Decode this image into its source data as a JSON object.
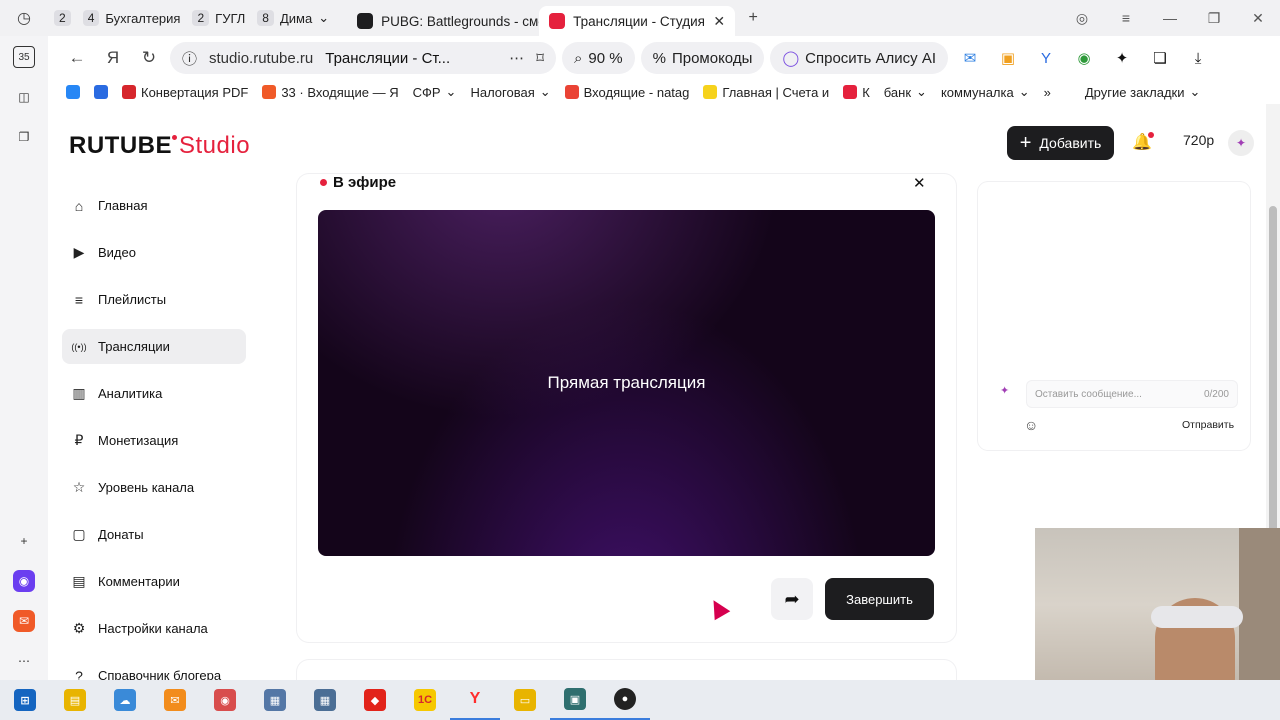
{
  "browser": {
    "tab_groups": [
      {
        "count": "2",
        "label": ""
      },
      {
        "count": "4",
        "label": "Бухгалтерия"
      },
      {
        "count": "2",
        "label": "ГУГЛ"
      },
      {
        "count": "8",
        "label": "Дима"
      }
    ],
    "tabs": [
      {
        "title": "PUBG: Battlegrounds - смо",
        "fav_color": "#1d1d1f"
      },
      {
        "title": "Трансляции - Студия R",
        "fav_color": "#e5213d",
        "active": true
      }
    ],
    "url": "studio.rutube.ru",
    "page_title": "Трансляции - Ст...",
    "zoom": "90 %",
    "promo_label": "Промокоды",
    "alice_label": "Спросить Алису AI",
    "bookmarks": [
      {
        "label": "Конвертация PDF",
        "color": "#d6262c"
      },
      {
        "label": "33 · Входящие — Я",
        "color": "#f05a28"
      },
      {
        "label": "СФР",
        "color": "#ffffff"
      },
      {
        "label": "Налоговая",
        "color": "#ffffff"
      },
      {
        "label": "Входящие - natag",
        "color": "#ea4335"
      },
      {
        "label": "Главная | Счета и",
        "color": "#f6d21c"
      },
      {
        "label": "К",
        "color": "#e5213d"
      },
      {
        "label": "банк",
        "color": "#ffffff"
      },
      {
        "label": "коммуналка",
        "color": "#ffffff"
      }
    ],
    "other_bookmarks": "Другие закладки",
    "side_badge": "35"
  },
  "app": {
    "logo_main": "RUTUBE",
    "logo_studio": "Studio",
    "add_button": "Добавить",
    "quality": "720p",
    "nav": [
      {
        "label": "Главная",
        "icon": "⌂"
      },
      {
        "label": "Видео",
        "icon": "▶"
      },
      {
        "label": "Плейлисты",
        "icon": "≡"
      },
      {
        "label": "Трансляции",
        "icon": "((•))",
        "active": true
      },
      {
        "label": "Аналитика",
        "icon": "▥"
      },
      {
        "label": "Монетизация",
        "icon": "₽"
      },
      {
        "label": "Уровень канала",
        "icon": "☆"
      },
      {
        "label": "Донаты",
        "icon": "▢"
      },
      {
        "label": "Комментарии",
        "icon": "▤"
      },
      {
        "label": "Настройки канала",
        "icon": "⚙"
      },
      {
        "label": "Справочник блогера",
        "icon": "?"
      }
    ],
    "live": {
      "header": "В эфире",
      "player_text": "Прямая трансляция",
      "finish_button": "Завершить"
    },
    "chat": {
      "placeholder": "Оставить сообщение...",
      "counter": "0/200",
      "send": "Отправить"
    }
  },
  "taskbar": {
    "apps": [
      {
        "name": "start",
        "color": "#1565c0",
        "glyph": "⊞"
      },
      {
        "name": "files",
        "color": "#e8b400",
        "glyph": "▤"
      },
      {
        "name": "cloud",
        "color": "#3a8ad8",
        "glyph": "☁"
      },
      {
        "name": "mail",
        "color": "#f28c1c",
        "glyph": "✉"
      },
      {
        "name": "disk",
        "color": "#d84d4d",
        "glyph": "◉"
      },
      {
        "name": "notes",
        "color": "#5477a6",
        "glyph": "▦"
      },
      {
        "name": "calc",
        "color": "#4b6e95",
        "glyph": "▦"
      },
      {
        "name": "anydesk",
        "color": "#e2231a",
        "glyph": "◆"
      },
      {
        "name": "1c",
        "color": "#f6c800",
        "glyph": "1С"
      },
      {
        "name": "yandex",
        "color": "#ff2d2d",
        "glyph": "Y"
      },
      {
        "name": "explorer",
        "color": "#e8b400",
        "glyph": "▭"
      },
      {
        "name": "app",
        "color": "#2f6f6f",
        "glyph": "▣"
      },
      {
        "name": "obs",
        "color": "#222222",
        "glyph": "●"
      }
    ]
  }
}
